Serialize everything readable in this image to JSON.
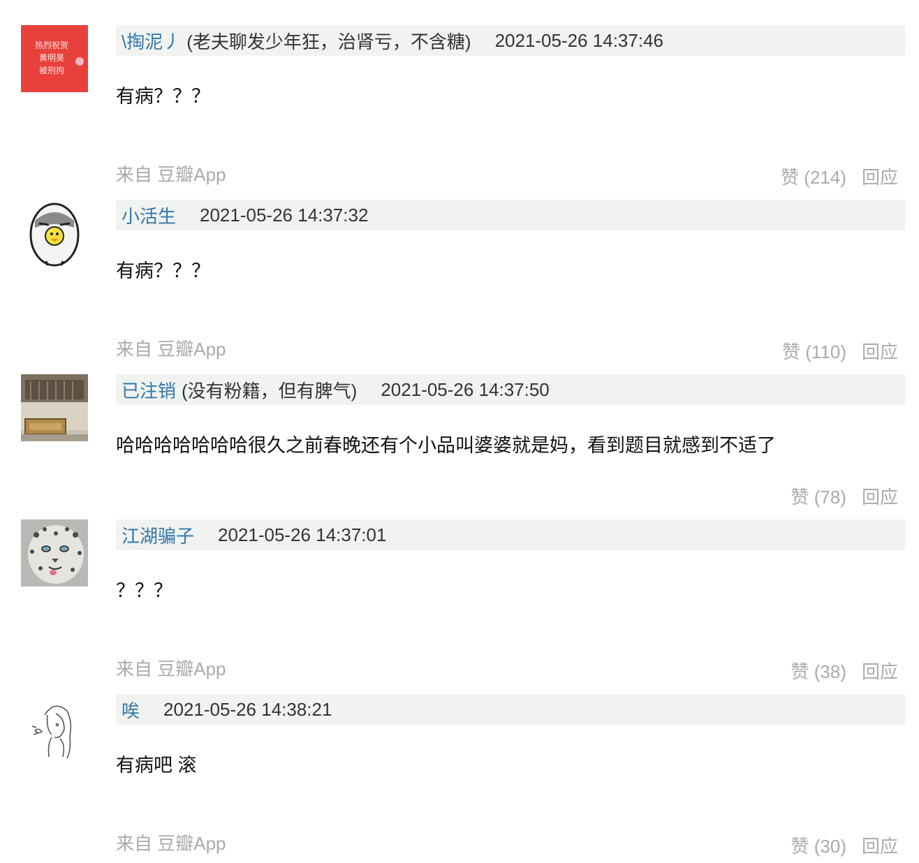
{
  "comments": [
    {
      "author": "\\掏泥丿",
      "signature": "(老夫聊发少年狂，治肾亏，不含糖)",
      "time": "2021-05-26 14:37:46",
      "text": "有病？？？",
      "source": "来自 豆瓣App",
      "like_label": "赞 (214)",
      "reply_label": "回应",
      "avatar": {
        "icon": "red-banner-avatar",
        "banner_text": [
          "热烈祝贺",
          "黄明昊",
          "被刑拘"
        ]
      }
    },
    {
      "author": "小活生",
      "signature": "",
      "time": "2021-05-26 14:37:32",
      "text": "有病？？？",
      "source": "来自 豆瓣App",
      "like_label": "赞 (110)",
      "reply_label": "回应",
      "avatar": {
        "icon": "cartoon-chick-avatar"
      }
    },
    {
      "author": "已注销",
      "signature": "(没有粉籍，但有脾气)",
      "time": "2021-05-26 14:37:50",
      "text": "哈哈哈哈哈哈哈很久之前春晚还有个小品叫婆婆就是妈，看到题目就感到不适了",
      "source": "",
      "like_label": "赞 (78)",
      "reply_label": "回应",
      "avatar": {
        "icon": "building-photo-avatar"
      }
    },
    {
      "author": "江湖骗子",
      "signature": "",
      "time": "2021-05-26 14:37:01",
      "text": "？？？",
      "source": "来自 豆瓣App",
      "like_label": "赞 (38)",
      "reply_label": "回应",
      "avatar": {
        "icon": "snow-leopard-avatar"
      }
    },
    {
      "author": "唉",
      "signature": "",
      "time": "2021-05-26 14:38:21",
      "text": "有病吧 滚",
      "source": "来自 豆瓣App",
      "like_label": "赞 (30)",
      "reply_label": "回应",
      "avatar": {
        "icon": "girl-sketch-avatar"
      }
    }
  ],
  "colors": {
    "author": "#3377aa",
    "header_bg": "#f0f3ef",
    "muted": "#aaaaaa",
    "avatar_red": "#e8413c"
  }
}
